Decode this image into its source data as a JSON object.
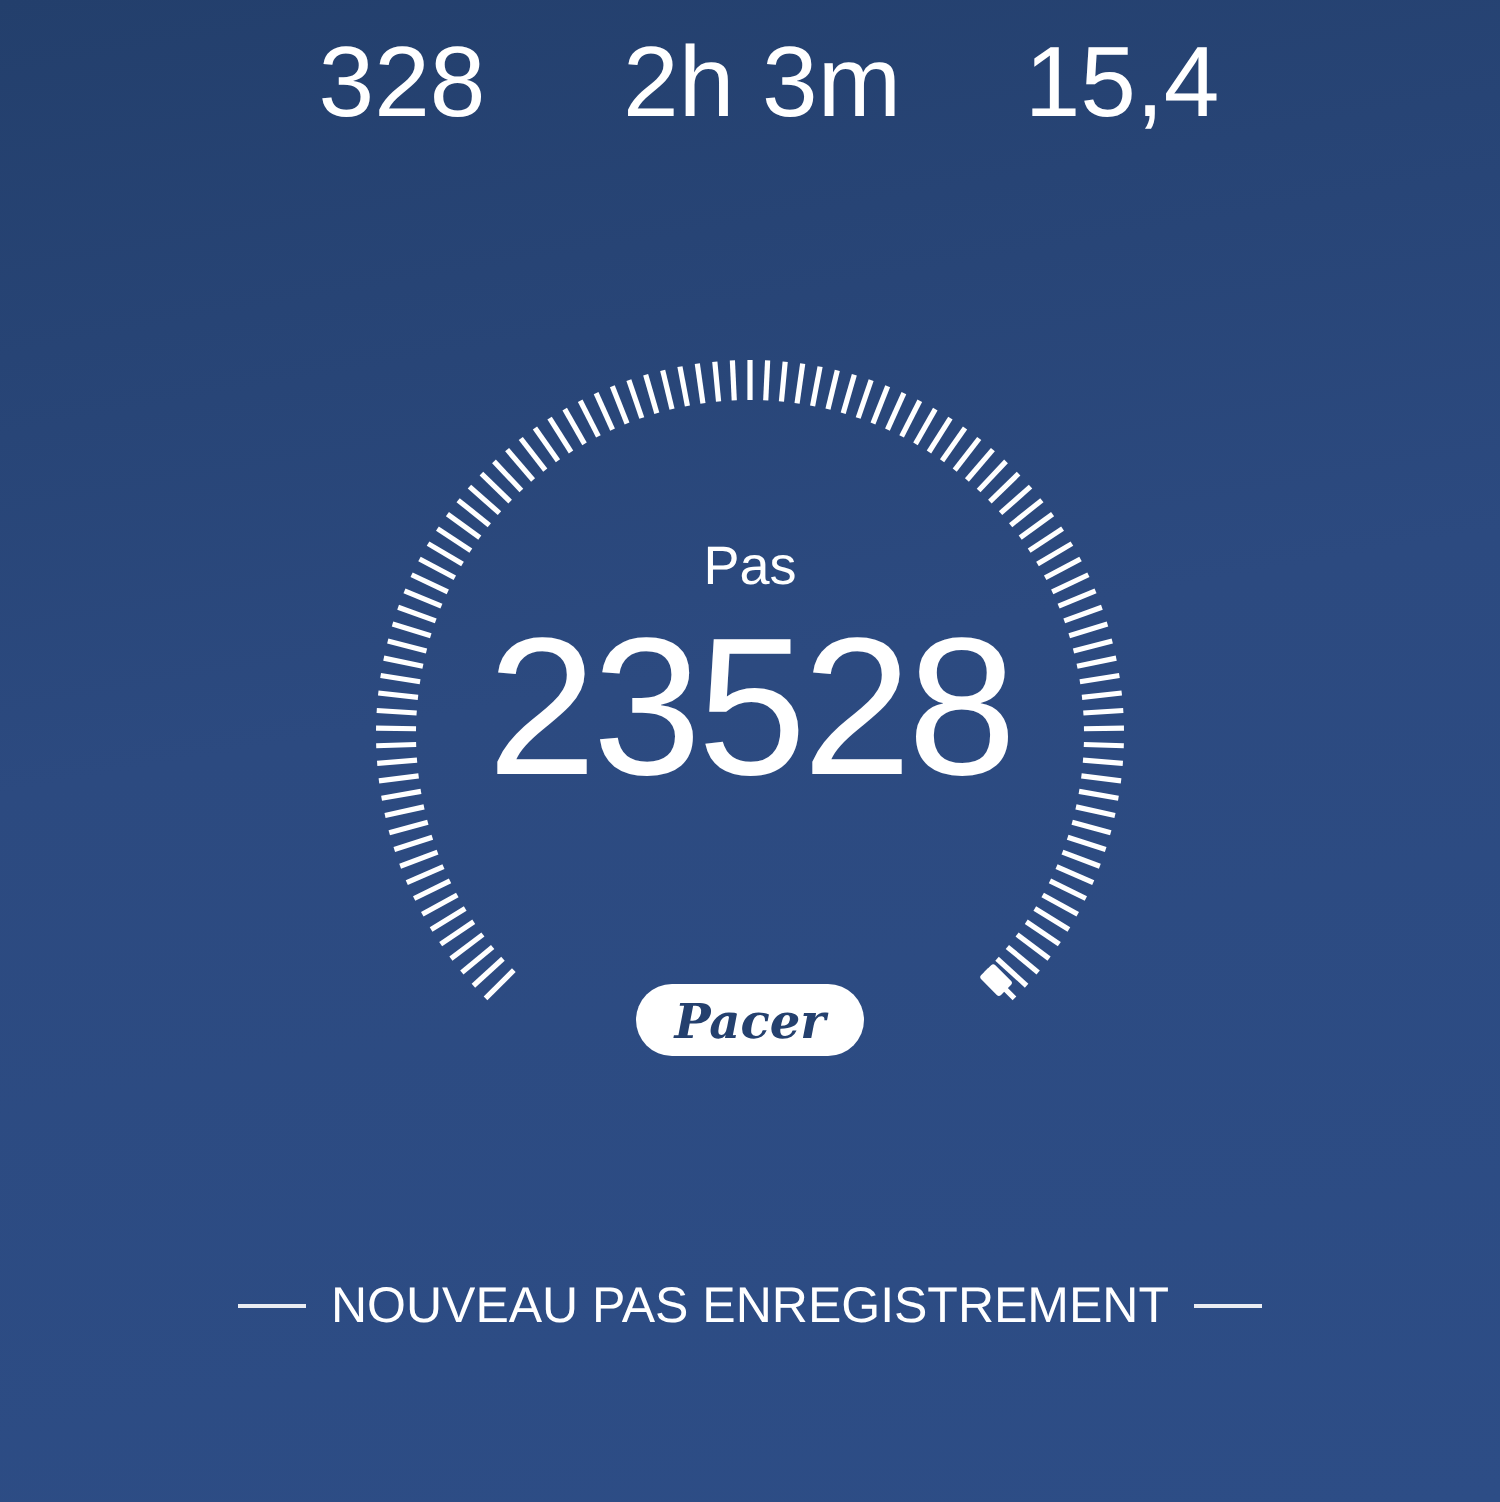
{
  "stats": [
    {
      "value": "328"
    },
    {
      "value": "2h 3m"
    },
    {
      "value": "15,4"
    }
  ],
  "gauge": {
    "label": "Pas",
    "value": "23528"
  },
  "logo": "Pacer",
  "banner": "NOUVEAU PAS ENREGISTREMENT"
}
